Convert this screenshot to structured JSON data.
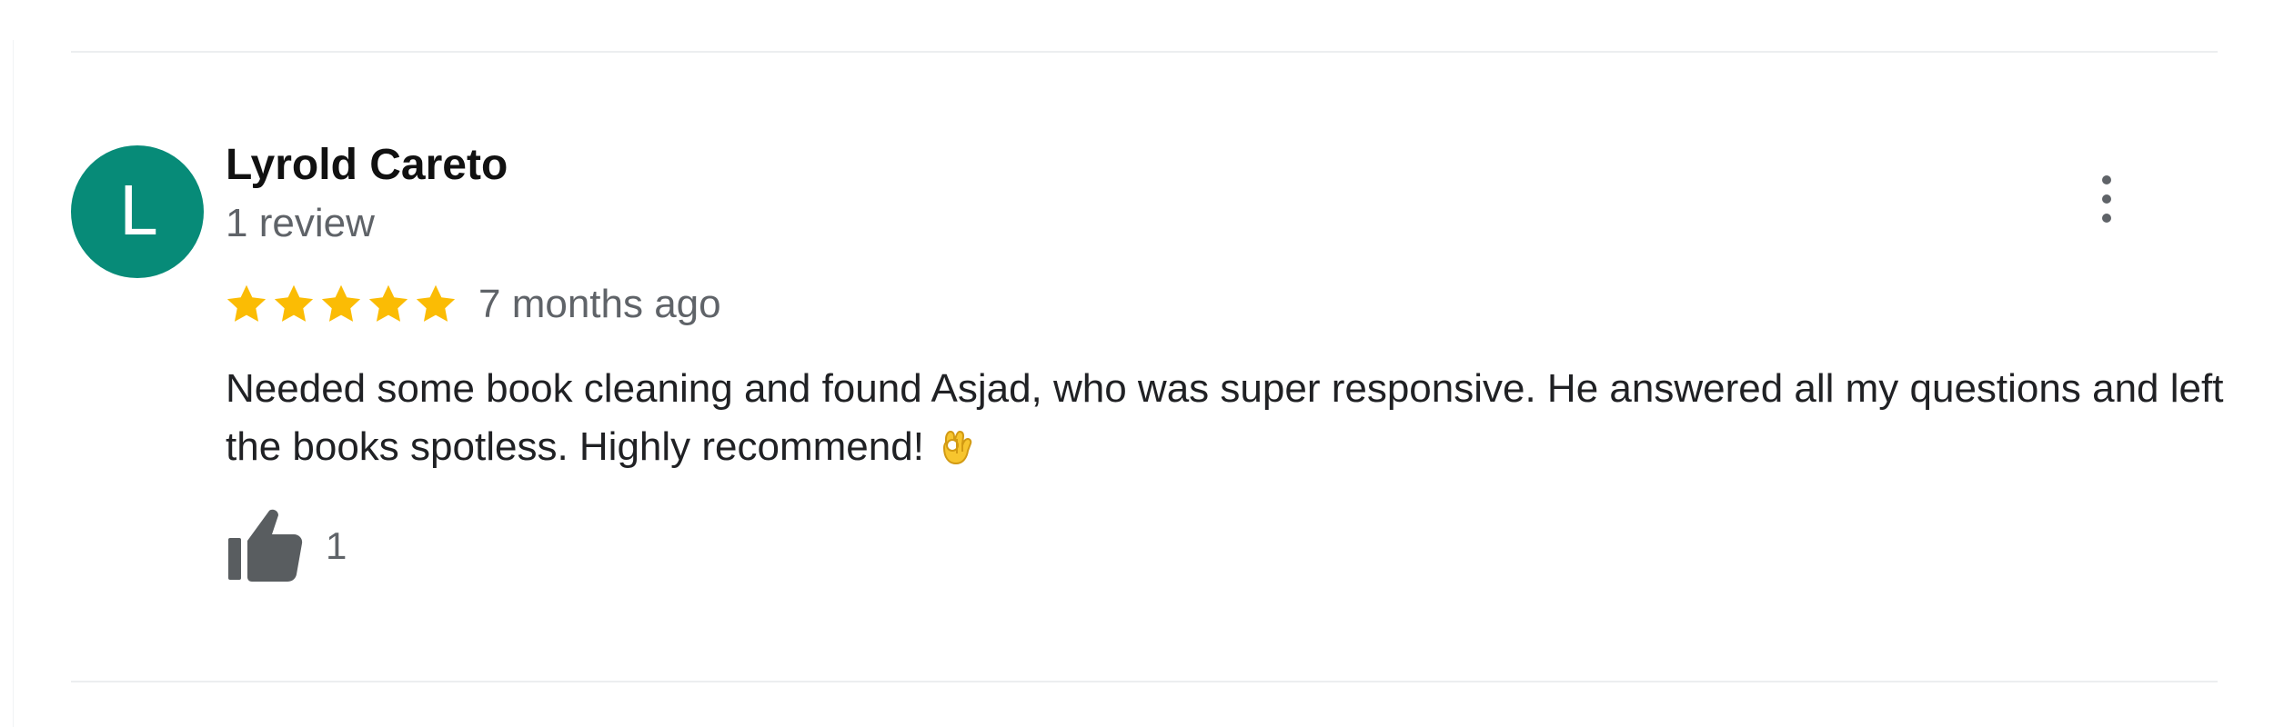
{
  "reviewer": {
    "initial": "L",
    "name": "Lyrold Careto",
    "review_count": "1 review",
    "avatar_color": "#078B78"
  },
  "review": {
    "rating": 5,
    "max_rating": 5,
    "date": "7 months ago",
    "text": "Needed some book cleaning and found Asjad, who was super responsive. He answered all my questions and left the books spotless. Highly recommend!",
    "emoji": "ok-hand-emoji",
    "star_color": "#FBBC04"
  },
  "actions": {
    "more_icon": "more-vert-icon",
    "like_icon": "thumb-up-icon",
    "like_count": "1"
  }
}
